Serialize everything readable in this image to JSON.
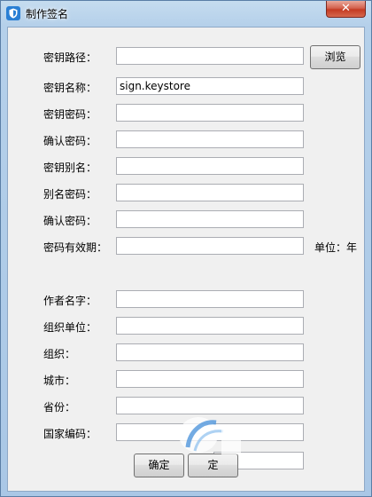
{
  "window": {
    "title": "制作签名",
    "close_label": "✕"
  },
  "fields": [
    {
      "label": "密钥路径：",
      "value": ""
    },
    {
      "label": "密钥名称：",
      "value": "sign.keystore"
    },
    {
      "label": "密钥密码：",
      "value": ""
    },
    {
      "label": "确认密码：",
      "value": ""
    },
    {
      "label": "密钥别名：",
      "value": ""
    },
    {
      "label": "别名密码：",
      "value": ""
    },
    {
      "label": "确认密码：",
      "value": ""
    },
    {
      "label": "密码有效期：",
      "value": ""
    },
    {
      "label": "作者名字：",
      "value": ""
    },
    {
      "label": "组织单位：",
      "value": ""
    },
    {
      "label": "组织：",
      "value": ""
    },
    {
      "label": "城市：",
      "value": ""
    },
    {
      "label": "省份：",
      "value": ""
    },
    {
      "label": "国家编码：",
      "value": ""
    }
  ],
  "browse_button": "浏览",
  "validity_unit": "单位：年",
  "footer": {
    "ok_label": "确定",
    "cancel_label": "定"
  },
  "icons": {
    "app": "shield-icon",
    "close": "close-icon"
  },
  "colors": {
    "title_bar": "#b5d0ea",
    "close_button": "#c43b22",
    "client_bg": "#f0f0f0"
  }
}
